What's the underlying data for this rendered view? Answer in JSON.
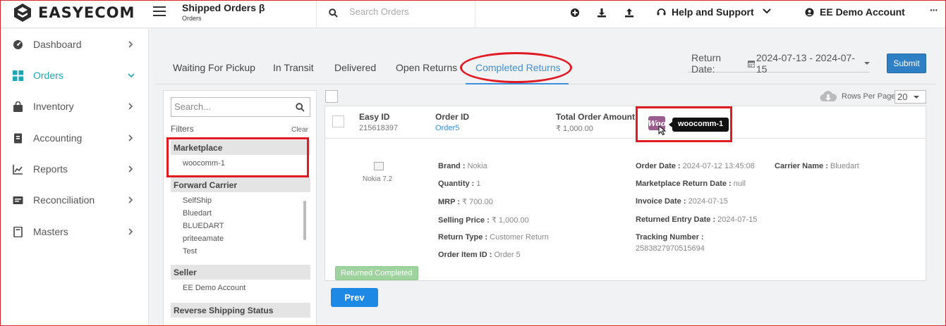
{
  "app": {
    "brand": "EASYECOM"
  },
  "header": {
    "title": "Shipped Orders β",
    "subtitle": "Orders",
    "search_placeholder": "Search Orders",
    "help_label": "Help and Support",
    "account_label": "EE Demo Account",
    "more_label": "···"
  },
  "sidebar": {
    "items": [
      {
        "label": "Dashboard",
        "icon": "dashboard-icon"
      },
      {
        "label": "Orders",
        "icon": "grid-icon",
        "active": true
      },
      {
        "label": "Inventory",
        "icon": "bag-icon"
      },
      {
        "label": "Accounting",
        "icon": "ledger-icon"
      },
      {
        "label": "Reports",
        "icon": "chart-icon"
      },
      {
        "label": "Reconciliation",
        "icon": "reconcile-icon"
      },
      {
        "label": "Masters",
        "icon": "book-icon"
      }
    ]
  },
  "tabs": [
    {
      "label": "Waiting For Pickup"
    },
    {
      "label": "In Transit"
    },
    {
      "label": "Delivered"
    },
    {
      "label": "Open Returns"
    },
    {
      "label": "Completed Returns",
      "active": true
    }
  ],
  "date_filter": {
    "label": "Return Date:",
    "value": "2024-07-13 - 2024-07-15"
  },
  "submit_label": "Submit",
  "filters": {
    "search_placeholder": "Search...",
    "title": "Filters",
    "clear_label": "Clear",
    "marketplace": {
      "heading": "Marketplace",
      "options": [
        "woocomm-1"
      ]
    },
    "forward_carrier": {
      "heading": "Forward Carrier",
      "options": [
        "SelfShip",
        "Bluedart",
        "BLUEDART",
        "priteeamate",
        "Test"
      ]
    },
    "seller": {
      "heading": "Seller",
      "options": [
        "EE Demo Account"
      ]
    },
    "reverse_shipping": {
      "heading": "Reverse Shipping Status"
    }
  },
  "pagination": {
    "rows_label": "Rows Per Page",
    "rows_value": "20",
    "prev_label": "Prev"
  },
  "order": {
    "easy_id_label": "Easy ID",
    "easy_id": "215618397",
    "order_id_label": "Order ID",
    "order_id": "Order5",
    "total_label": "Total Order Amount",
    "total": "₹ 1,000.00",
    "marketplace_tooltip": "woocomm-1",
    "marketplace_logo_text": "Woo",
    "product_name": "Nokia 7.2",
    "brand_label": "Brand :",
    "brand": "Nokia",
    "quantity_label": "Quantity :",
    "quantity": "1",
    "mrp_label": "MRP :",
    "mrp": "₹ 700.00",
    "selling_price_label": "Selling Price :",
    "selling_price": "₹ 1,000.00",
    "return_type_label": "Return Type :",
    "return_type": "Customer Return",
    "order_item_id_label": "Order Item ID :",
    "order_item_id": "Order 5",
    "order_date_label": "Order Date :",
    "order_date": "2024-07-12 13:45:08",
    "mp_return_date_label": "Marketplace Return Date :",
    "mp_return_date": "null",
    "invoice_date_label": "Invoice Date :",
    "invoice_date": "2024-07-15",
    "returned_entry_date_label": "Returned Entry Date :",
    "returned_entry_date": "2024-07-15",
    "tracking_label": "Tracking Number :",
    "tracking_number": "2583827970515694",
    "carrier_label": "Carrier Name :",
    "carrier": "Bluedart",
    "status": "Returned Completed"
  },
  "colors": {
    "accent": "#1fa6b5",
    "link": "#3c8fd9",
    "annotation": "#e01b22",
    "success": "#9ed29e",
    "woo": "#9b5c8f"
  }
}
